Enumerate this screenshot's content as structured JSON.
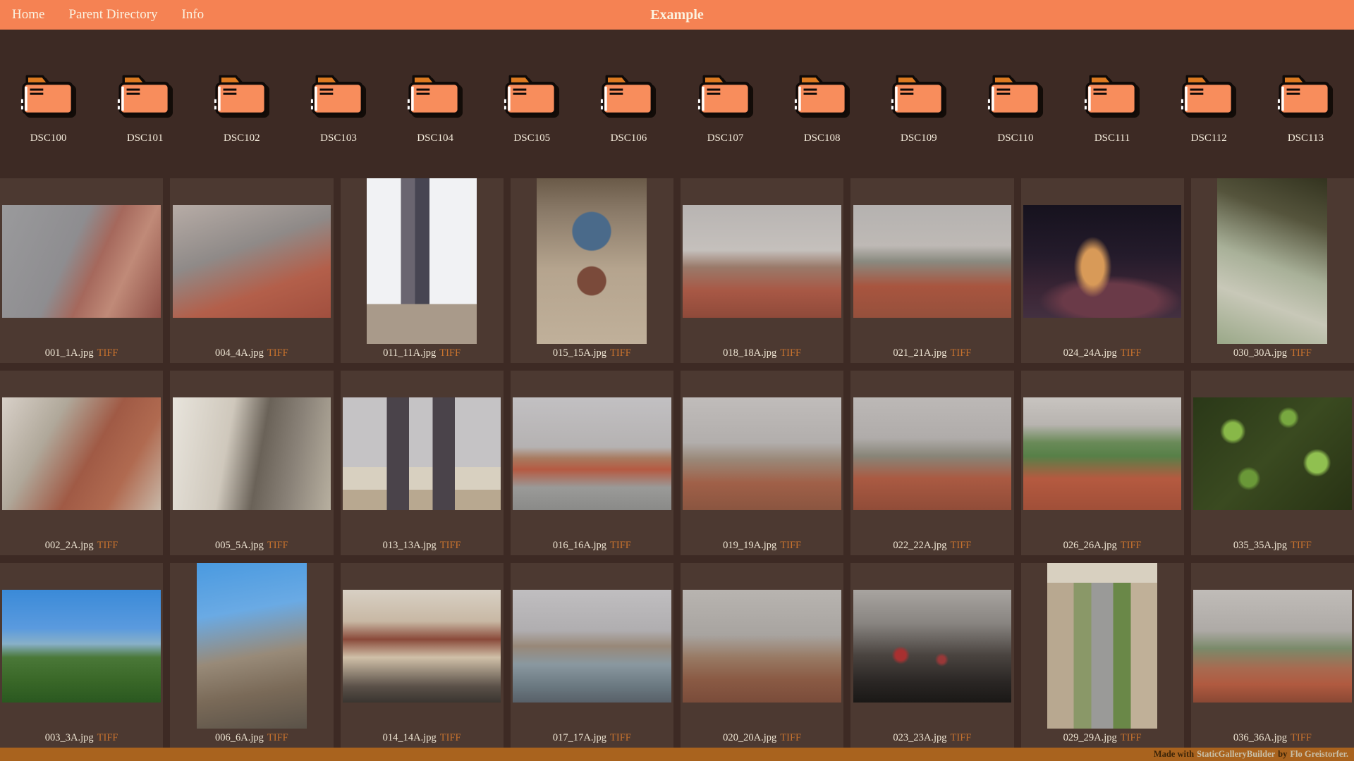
{
  "nav": {
    "title": "Example",
    "links": [
      {
        "label": "Home"
      },
      {
        "label": "Parent Directory"
      },
      {
        "label": "Info"
      }
    ]
  },
  "folders": [
    {
      "name": "DSC100"
    },
    {
      "name": "DSC101"
    },
    {
      "name": "DSC102"
    },
    {
      "name": "DSC103"
    },
    {
      "name": "DSC104"
    },
    {
      "name": "DSC105"
    },
    {
      "name": "DSC106"
    },
    {
      "name": "DSC107"
    },
    {
      "name": "DSC108"
    },
    {
      "name": "DSC109"
    },
    {
      "name": "DSC110"
    },
    {
      "name": "DSC111"
    },
    {
      "name": "DSC112"
    },
    {
      "name": "DSC113"
    }
  ],
  "photos": [
    {
      "filename": "001_1A.jpg",
      "alt_format": "TIFF",
      "orientation": "landscape",
      "art": "p1"
    },
    {
      "filename": "004_4A.jpg",
      "alt_format": "TIFF",
      "orientation": "landscape",
      "art": "p2"
    },
    {
      "filename": "011_11A.jpg",
      "alt_format": "TIFF",
      "orientation": "portrait",
      "art": "p3"
    },
    {
      "filename": "015_15A.jpg",
      "alt_format": "TIFF",
      "orientation": "portrait",
      "art": "p4"
    },
    {
      "filename": "018_18A.jpg",
      "alt_format": "TIFF",
      "orientation": "landscape",
      "art": "p5"
    },
    {
      "filename": "021_21A.jpg",
      "alt_format": "TIFF",
      "orientation": "landscape",
      "art": "p6"
    },
    {
      "filename": "024_24A.jpg",
      "alt_format": "TIFF",
      "orientation": "landscape",
      "art": "p7"
    },
    {
      "filename": "030_30A.jpg",
      "alt_format": "TIFF",
      "orientation": "portrait",
      "art": "p8"
    },
    {
      "filename": "002_2A.jpg",
      "alt_format": "TIFF",
      "orientation": "landscape",
      "art": "p9"
    },
    {
      "filename": "005_5A.jpg",
      "alt_format": "TIFF",
      "orientation": "landscape",
      "art": "p10"
    },
    {
      "filename": "013_13A.jpg",
      "alt_format": "TIFF",
      "orientation": "landscape",
      "art": "p11"
    },
    {
      "filename": "016_16A.jpg",
      "alt_format": "TIFF",
      "orientation": "landscape",
      "art": "p12"
    },
    {
      "filename": "019_19A.jpg",
      "alt_format": "TIFF",
      "orientation": "landscape",
      "art": "p13"
    },
    {
      "filename": "022_22A.jpg",
      "alt_format": "TIFF",
      "orientation": "landscape",
      "art": "p14"
    },
    {
      "filename": "026_26A.jpg",
      "alt_format": "TIFF",
      "orientation": "landscape",
      "art": "p15"
    },
    {
      "filename": "035_35A.jpg",
      "alt_format": "TIFF",
      "orientation": "landscape",
      "art": "p16"
    },
    {
      "filename": "003_3A.jpg",
      "alt_format": "TIFF",
      "orientation": "landscape",
      "art": "p17"
    },
    {
      "filename": "006_6A.jpg",
      "alt_format": "TIFF",
      "orientation": "portrait",
      "art": "p18"
    },
    {
      "filename": "014_14A.jpg",
      "alt_format": "TIFF",
      "orientation": "landscape",
      "art": "p19"
    },
    {
      "filename": "017_17A.jpg",
      "alt_format": "TIFF",
      "orientation": "landscape",
      "art": "p20"
    },
    {
      "filename": "020_20A.jpg",
      "alt_format": "TIFF",
      "orientation": "landscape",
      "art": "p21"
    },
    {
      "filename": "023_23A.jpg",
      "alt_format": "TIFF",
      "orientation": "landscape",
      "art": "p22"
    },
    {
      "filename": "029_29A.jpg",
      "alt_format": "TIFF",
      "orientation": "portrait",
      "art": "p23"
    },
    {
      "filename": "036_36A.jpg",
      "alt_format": "TIFF",
      "orientation": "landscape",
      "art": "p24"
    }
  ],
  "footer": {
    "made_with": "Made with",
    "builder_link": "StaticGalleryBuilder",
    "by": "by",
    "author_link": "Flo Greistorfer."
  },
  "colors": {
    "nav_bg": "#f58253",
    "page_bg": "#3d2a24",
    "cell_bg": "#4c3931",
    "footer_bg": "#a9631e",
    "folder_body": "#f88d5c",
    "folder_tab": "#dd7a20",
    "link_cream": "#efe6d4",
    "link_orange": "#c7722e"
  }
}
